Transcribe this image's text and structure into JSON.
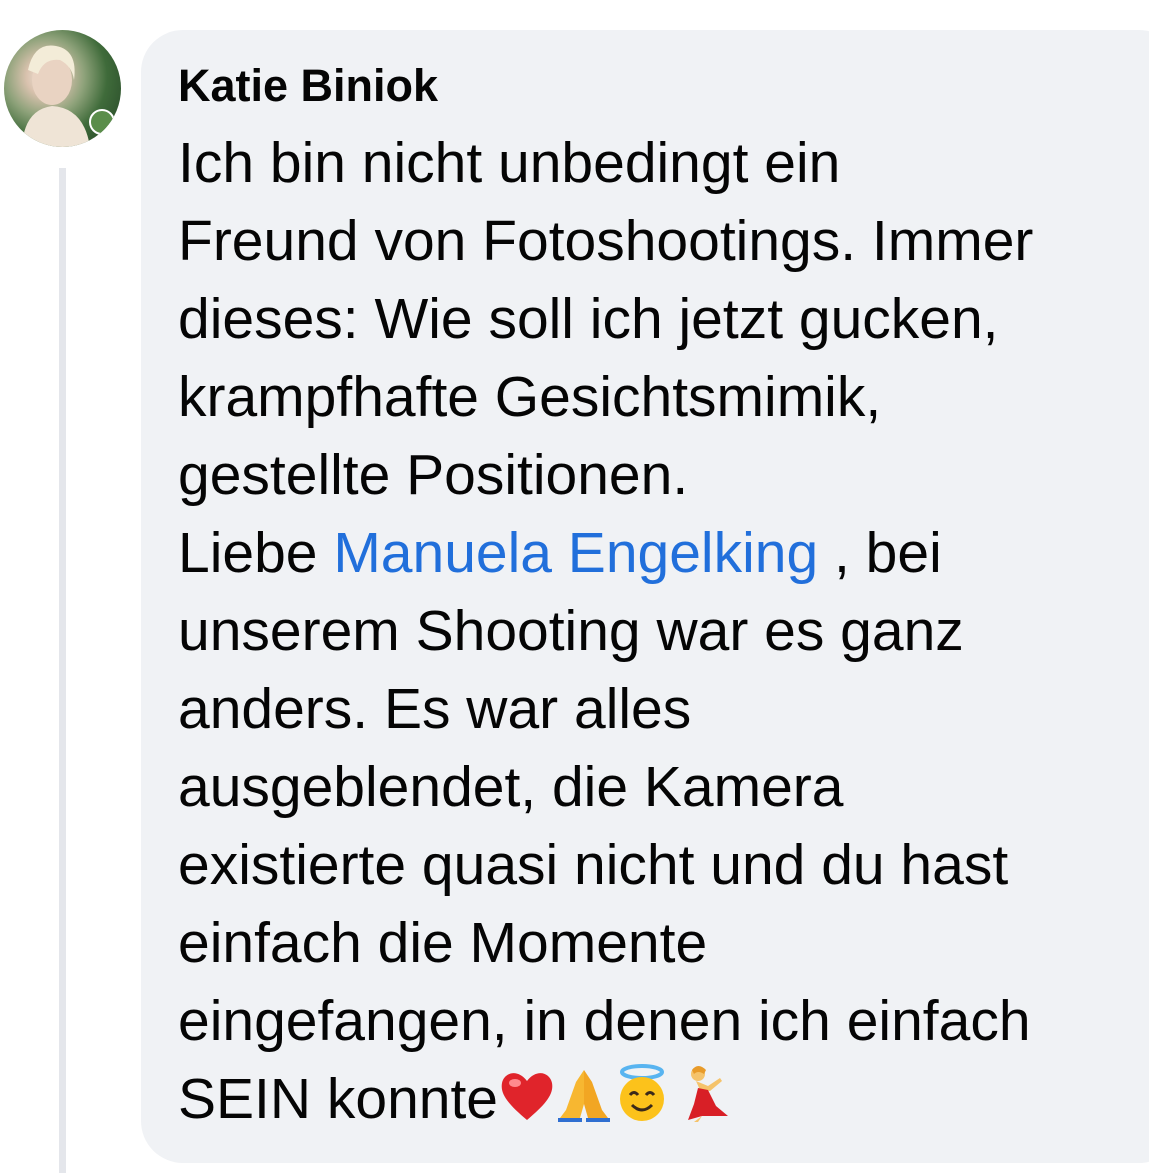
{
  "comment": {
    "author": "Katie Biniok",
    "lines": [
      "Ich bin nicht unbedingt ein",
      "Freund von Fotoshootings. Immer",
      "dieses: Wie soll ich jetzt gucken,",
      "krampfhafte Gesichtsmimik,",
      "gestellte Positionen."
    ],
    "mention_prefix": "Liebe ",
    "mention": "Manuela Engelking",
    "mention_suffix": " , bei",
    "lines_after": [
      "unserem Shooting war es ganz",
      "anders. Es war alles",
      "ausgeblendet,  die Kamera",
      "existierte quasi nicht und du hast",
      "einfach die Momente",
      "eingefangen, in denen ich einfach"
    ],
    "last_line": "SEIN konnte",
    "emojis": [
      "heart-icon",
      "praying-hands-icon",
      "smiling-face-with-halo-icon",
      "dancer-icon"
    ]
  },
  "colors": {
    "bubble": "#f0f2f5",
    "text": "#050505",
    "mention": "#216fdb",
    "thread_line": "#e4e6eb"
  }
}
